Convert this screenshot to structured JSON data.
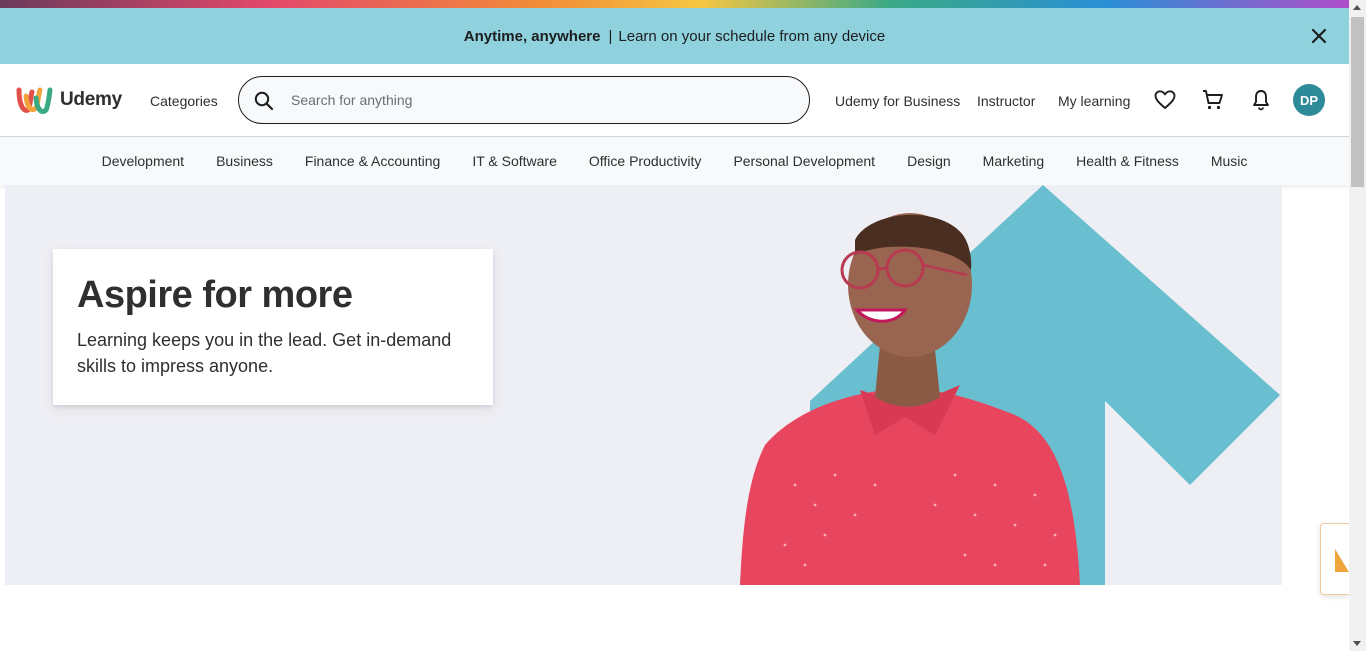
{
  "banner": {
    "bold_text": "Anytime, anywhere",
    "separator": "|",
    "text": "Learn on your schedule from any device"
  },
  "header": {
    "logo_text": "Udemy",
    "categories_label": "Categories",
    "search_placeholder": "Search for anything",
    "links": {
      "business": "Udemy for Business",
      "instructor": "Instructor",
      "my_learning": "My learning"
    },
    "avatar_initials": "DP"
  },
  "category_nav": [
    "Development",
    "Business",
    "Finance & Accounting",
    "IT & Software",
    "Office Productivity",
    "Personal Development",
    "Design",
    "Marketing",
    "Health & Fitness",
    "Music"
  ],
  "hero": {
    "title": "Aspire for more",
    "subtitle": "Learning keeps you in the lead. Get in-demand skills to impress anyone."
  },
  "colors": {
    "banner_bg": "#8fd1dd",
    "hero_bg": "#eeeff4",
    "arrow_teal": "#69bfcf",
    "shirt_red": "#e8455f",
    "avatar_bg": "#2d8a98"
  },
  "icons": {
    "close": "close-icon",
    "search": "search-icon",
    "wishlist": "heart-icon",
    "cart": "cart-icon",
    "notifications": "bell-icon"
  }
}
